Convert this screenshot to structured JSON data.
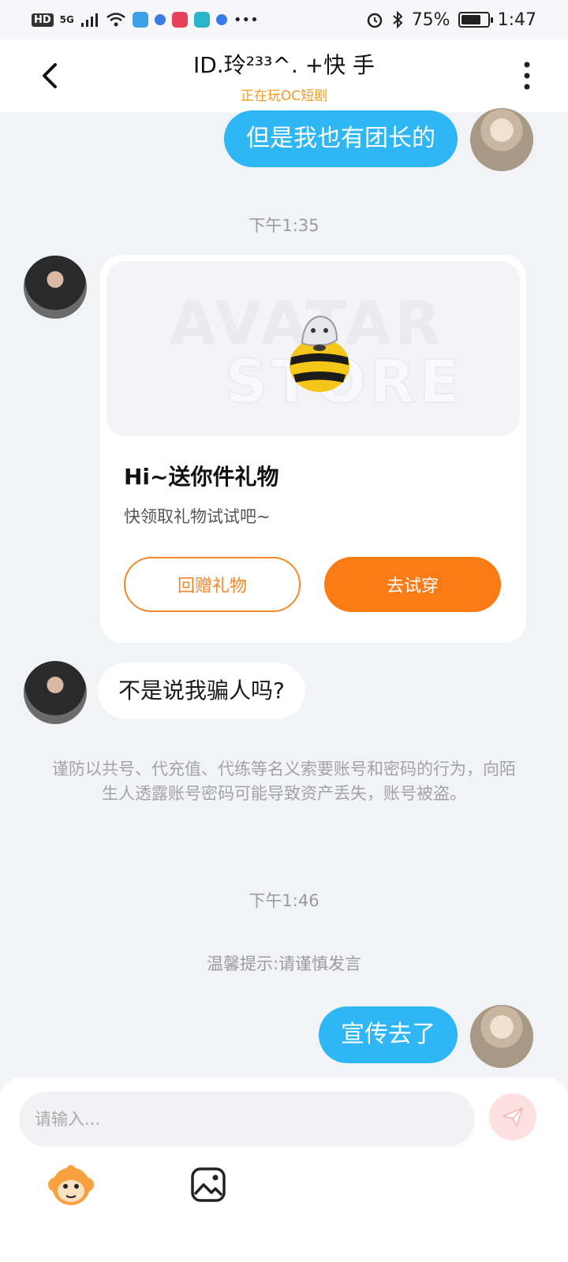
{
  "status_bar": {
    "hd": "HD",
    "network": "5G",
    "battery": "75%",
    "battery_level": 0.75,
    "time": "1:47",
    "icons": [
      "signal-icon",
      "wifi-icon",
      "weather-icon",
      "app-icon",
      "app-icon",
      "app-icon",
      "app-icon",
      "more-icon",
      "alarm-icon",
      "bluetooth-icon",
      "battery-icon"
    ]
  },
  "header": {
    "title": "ID.玲²³³^. +快 手",
    "subtitle": "正在玩OC短剧"
  },
  "messages": {
    "m1_text": "但是我也有团长的",
    "time1": "下午1:35",
    "gift": {
      "watermark_line1": "AVATAR",
      "watermark_line2": "STORE",
      "title": "Hi~送你件礼物",
      "desc": "快领取礼物试试吧~",
      "btn_return": "回赠礼物",
      "btn_try": "去试穿"
    },
    "m2_text": "不是说我骗人吗?",
    "notice": "谨防以共号、代充值、代练等名义索要账号和密码的行为，向陌生人透露账号密码可能导致资产丢失，账号被盗。",
    "time2": "下午1:46",
    "tip": "温馨提示:请谨慎发言",
    "m3_text": "宣传去了"
  },
  "input": {
    "placeholder": "请输入..."
  },
  "colors": {
    "my_bubble": "#2fb6f4",
    "accent_orange": "#fb7b14",
    "subtitle_orange": "#f39a1e",
    "background": "#f2f3f7"
  }
}
